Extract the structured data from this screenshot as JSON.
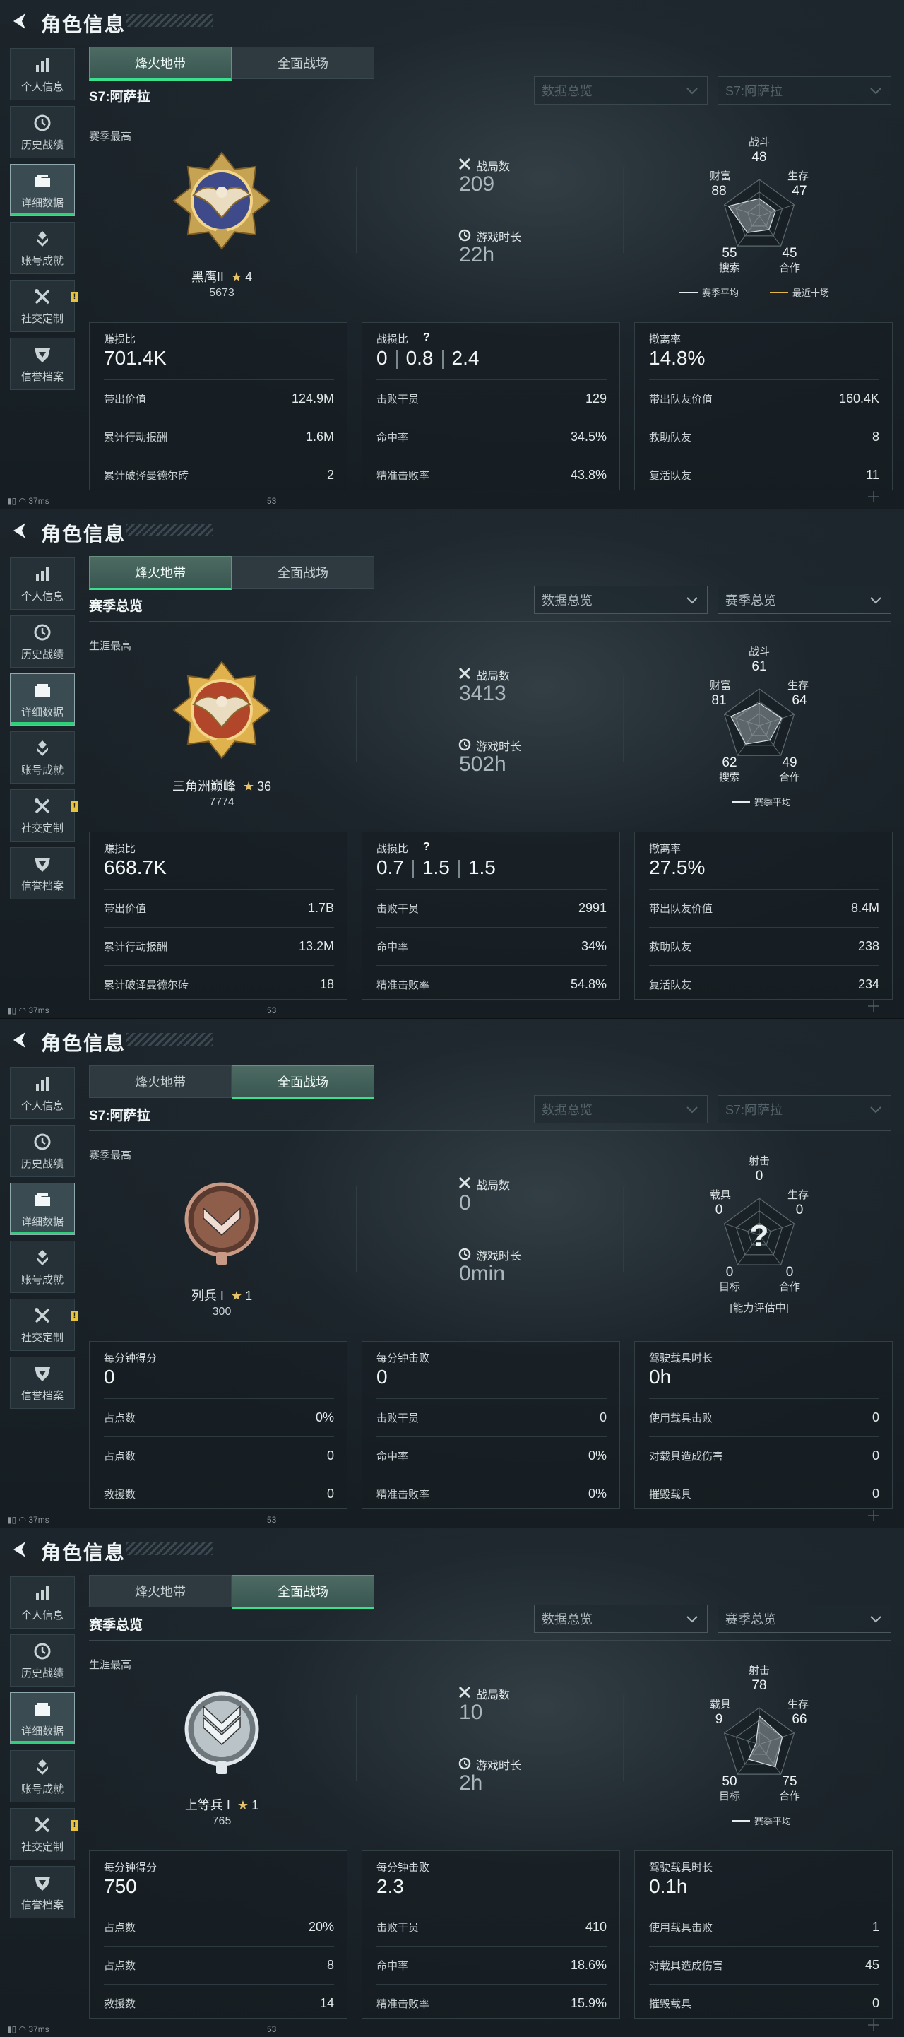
{
  "common": {
    "page_title": "角色信息",
    "sidebar": [
      "个人信息",
      "历史战绩",
      "详细数据",
      "账号成就",
      "社交定制",
      "信誉档案"
    ],
    "sidebar_alert": "!",
    "tabs": [
      "烽火地带",
      "全面战场"
    ],
    "battle_count_label": "战局数",
    "play_time_label": "游戏时长",
    "status_ping": "37ms",
    "status_num": "53",
    "colors": {
      "accent": "#3be08f",
      "gold": "#e5c36a"
    }
  },
  "panels": [
    {
      "active_tab": 0,
      "subtitle": "S7:阿萨拉",
      "dropdown1": "数据总览",
      "dropdown2": "S7:阿萨拉",
      "dropdowns_dim": true,
      "section_label": "赛季最高",
      "badge": "eagle-blue",
      "rank_name": "黑鹰II",
      "rank_stars": "4",
      "rank_score": "5673",
      "battle_count": "209",
      "play_time": "22h",
      "radar": {
        "labels": [
          "战斗",
          "生存",
          "合作",
          "搜索",
          "财富"
        ],
        "values": [
          "48",
          "47",
          "45",
          "55",
          "88"
        ],
        "levels": [
          0.48,
          0.47,
          0.45,
          0.55,
          0.88
        ],
        "legend": [
          "赛季平均",
          "最近十场"
        ],
        "unknown": false
      },
      "cards": [
        {
          "label": "赚损比",
          "big": "701.4K",
          "rows": [
            [
              "带出价值",
              "124.9M"
            ],
            [
              "累计行动报酬",
              "1.6M"
            ],
            [
              "累计破译曼德尔砖",
              "2"
            ]
          ]
        },
        {
          "label": "战损比",
          "kd": [
            "0",
            "0.8",
            "2.4"
          ],
          "q": "?",
          "rows": [
            [
              "击败干员",
              "129"
            ],
            [
              "命中率",
              "34.5%"
            ],
            [
              "精准击败率",
              "43.8%"
            ]
          ]
        },
        {
          "label": "撤离率",
          "big": "14.8%",
          "rows": [
            [
              "带出队友价值",
              "160.4K"
            ],
            [
              "救助队友",
              "8"
            ],
            [
              "复活队友",
              "11"
            ]
          ]
        }
      ]
    },
    {
      "active_tab": 0,
      "subtitle": "赛季总览",
      "dropdown1": "数据总览",
      "dropdown2": "赛季总览",
      "dropdowns_dim": false,
      "section_label": "生涯最高",
      "badge": "eagle-gold",
      "rank_name": "三角洲巅峰",
      "rank_stars": "36",
      "rank_score": "7774",
      "battle_count": "3413",
      "play_time": "502h",
      "radar": {
        "labels": [
          "战斗",
          "生存",
          "合作",
          "搜索",
          "财富"
        ],
        "values": [
          "61",
          "64",
          "49",
          "62",
          "81"
        ],
        "levels": [
          0.61,
          0.64,
          0.49,
          0.62,
          0.81
        ],
        "legend": [
          "赛季平均"
        ],
        "unknown": false
      },
      "cards": [
        {
          "label": "赚损比",
          "big": "668.7K",
          "rows": [
            [
              "带出价值",
              "1.7B"
            ],
            [
              "累计行动报酬",
              "13.2M"
            ],
            [
              "累计破译曼德尔砖",
              "18"
            ]
          ]
        },
        {
          "label": "战损比",
          "kd": [
            "0.7",
            "1.5",
            "1.5"
          ],
          "q": "?",
          "rows": [
            [
              "击败干员",
              "2991"
            ],
            [
              "命中率",
              "34%"
            ],
            [
              "精准击败率",
              "54.8%"
            ]
          ]
        },
        {
          "label": "撤离率",
          "big": "27.5%",
          "rows": [
            [
              "带出队友价值",
              "8.4M"
            ],
            [
              "救助队友",
              "238"
            ],
            [
              "复活队友",
              "234"
            ]
          ]
        }
      ]
    },
    {
      "active_tab": 1,
      "subtitle": "S7:阿萨拉",
      "dropdown1": "数据总览",
      "dropdown2": "S7:阿萨拉",
      "dropdowns_dim": true,
      "section_label": "赛季最高",
      "badge": "chevron-bronze",
      "rank_name": "列兵 I",
      "rank_stars": "1",
      "rank_score": "300",
      "battle_count": "0",
      "play_time": "0min",
      "radar": {
        "labels": [
          "射击",
          "生存",
          "合作",
          "目标",
          "载具"
        ],
        "values": [
          "0",
          "0",
          "0",
          "0",
          "0"
        ],
        "levels": [
          0,
          0,
          0,
          0,
          0
        ],
        "legend": [],
        "unknown": true,
        "unknown_mark": "?",
        "caption": "[能力评估中]"
      },
      "cards": [
        {
          "label": "每分钟得分",
          "big": "0",
          "rows": [
            [
              "占点数",
              "0%"
            ],
            [
              "占点数",
              "0"
            ],
            [
              "救援数",
              "0"
            ]
          ]
        },
        {
          "label": "每分钟击败",
          "big": "0",
          "rows": [
            [
              "击败干员",
              "0"
            ],
            [
              "命中率",
              "0%"
            ],
            [
              "精准击败率",
              "0%"
            ]
          ]
        },
        {
          "label": "驾驶载具时长",
          "big": "0h",
          "rows": [
            [
              "使用载具击败",
              "0"
            ],
            [
              "对载具造成伤害",
              "0"
            ],
            [
              "摧毁载具",
              "0"
            ]
          ]
        }
      ]
    },
    {
      "active_tab": 1,
      "subtitle": "赛季总览",
      "dropdown1": "数据总览",
      "dropdown2": "赛季总览",
      "dropdowns_dim": false,
      "section_label": "生涯最高",
      "badge": "chevron-silver",
      "rank_name": "上等兵 I",
      "rank_stars": "1",
      "rank_score": "765",
      "battle_count": "10",
      "play_time": "2h",
      "radar": {
        "labels": [
          "射击",
          "生存",
          "合作",
          "目标",
          "载具"
        ],
        "values": [
          "78",
          "66",
          "75",
          "50",
          "9"
        ],
        "levels": [
          0.78,
          0.66,
          0.75,
          0.5,
          0.09
        ],
        "legend": [
          "赛季平均"
        ],
        "unknown": false
      },
      "cards": [
        {
          "label": "每分钟得分",
          "big": "750",
          "rows": [
            [
              "占点数",
              "20%"
            ],
            [
              "占点数",
              "8"
            ],
            [
              "救援数",
              "14"
            ]
          ]
        },
        {
          "label": "每分钟击败",
          "big": "2.3",
          "rows": [
            [
              "击败干员",
              "410"
            ],
            [
              "命中率",
              "18.6%"
            ],
            [
              "精准击败率",
              "15.9%"
            ]
          ]
        },
        {
          "label": "驾驶载具时长",
          "big": "0.1h",
          "rows": [
            [
              "使用载具击败",
              "1"
            ],
            [
              "对载具造成伤害",
              "45"
            ],
            [
              "摧毁载具",
              "0"
            ]
          ]
        }
      ]
    }
  ]
}
